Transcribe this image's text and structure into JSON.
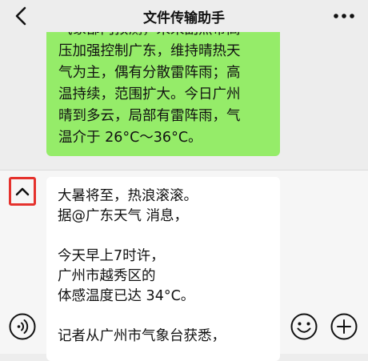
{
  "header": {
    "title": "文件传输助手",
    "back_icon": "chevron-left-icon",
    "more_icon": "more-dots-icon"
  },
  "sent_message": {
    "text": "气象部门预测，未来副热带高\n压加强控制广东，维持晴热天\n气为主，偶有分散雷阵雨；高\n温持续，范围扩大。今日广州\n晴到多云，局部有雷阵雨，气\n温介于 26°C～36°C。",
    "bubble_color": "#95ec69"
  },
  "composer": {
    "collapse_icon": "chevron-up-icon",
    "highlight_color": "#e5322d",
    "draft_text": "大暑将至，热浪滚滚。\n据@广东天气 消息，\n\n今天早上7时许，\n广州市越秀区的\n体感温度已达 34°C。\n\n记者从广州市气象台获悉，",
    "voice_icon": "voice-icon",
    "emoji_icon": "emoji-icon",
    "plus_icon": "plus-circle-icon"
  }
}
